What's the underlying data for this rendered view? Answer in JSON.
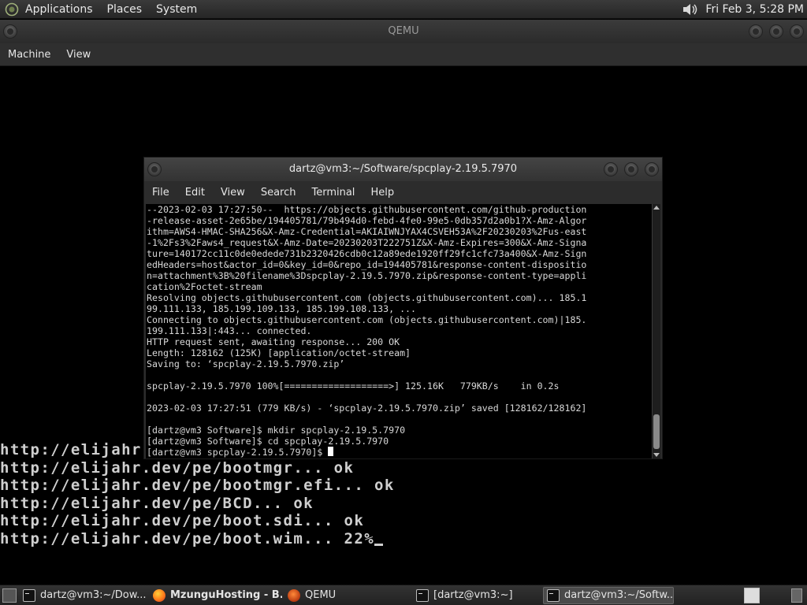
{
  "top_panel": {
    "menus": [
      "Applications",
      "Places",
      "System"
    ],
    "clock": "Fri Feb  3, 5:28 PM"
  },
  "qemu": {
    "title": "QEMU",
    "menus": [
      "Machine",
      "View"
    ],
    "screen_lines": [
      "http://elijahr",
      "http://elijahr.dev/pe/bootmgr... ok",
      "http://elijahr.dev/pe/bootmgr.efi... ok",
      "http://elijahr.dev/pe/BCD... ok",
      "http://elijahr.dev/pe/boot.sdi... ok",
      "http://elijahr.dev/pe/boot.wim... 22%"
    ]
  },
  "terminal": {
    "title": "dartz@vm3:~/Software/spcplay-2.19.5.7970",
    "menus": [
      "File",
      "Edit",
      "View",
      "Search",
      "Terminal",
      "Help"
    ],
    "lines": [
      "--2023-02-03 17:27:50--  https://objects.githubusercontent.com/github-production",
      "-release-asset-2e65be/194405781/79b494d0-febd-4fe0-99e5-0db357d2a0b1?X-Amz-Algor",
      "ithm=AWS4-HMAC-SHA256&X-Amz-Credential=AKIAIWNJYAX4CSVEH53A%2F20230203%2Fus-east",
      "-1%2Fs3%2Faws4_request&X-Amz-Date=20230203T222751Z&X-Amz-Expires=300&X-Amz-Signa",
      "ture=140172cc11c0de0edede731b2320426cdb0c12a89ede1920ff29fc1cfc73a400&X-Amz-Sign",
      "edHeaders=host&actor_id=0&key_id=0&repo_id=194405781&response-content-dispositio",
      "n=attachment%3B%20filename%3Dspcplay-2.19.5.7970.zip&response-content-type=appli",
      "cation%2Foctet-stream",
      "Resolving objects.githubusercontent.com (objects.githubusercontent.com)... 185.1",
      "99.111.133, 185.199.109.133, 185.199.108.133, ...",
      "Connecting to objects.githubusercontent.com (objects.githubusercontent.com)|185.",
      "199.111.133|:443... connected.",
      "HTTP request sent, awaiting response... 200 OK",
      "Length: 128162 (125K) [application/octet-stream]",
      "Saving to: ‘spcplay-2.19.5.7970.zip’",
      "",
      "spcplay-2.19.5.7970 100%[===================>] 125.16K   779KB/s    in 0.2s",
      "",
      "2023-02-03 17:27:51 (779 KB/s) - ‘spcplay-2.19.5.7970.zip’ saved [128162/128162]",
      "",
      "[dartz@vm3 Software]$ mkdir spcplay-2.19.5.7970",
      "[dartz@vm3 Software]$ cd spcplay-2.19.5.7970"
    ],
    "prompt": "[dartz@vm3 spcplay-2.19.5.7970]$ "
  },
  "taskbar": {
    "tasks": [
      {
        "label": "dartz@vm3:~/Dow...",
        "icon": "terminal-icon"
      },
      {
        "label": "MzunguHosting - B...",
        "icon": "firefox-icon"
      },
      {
        "label": "QEMU",
        "icon": "qemu-icon"
      },
      {
        "label": "[dartz@vm3:~]",
        "icon": "terminal-icon"
      },
      {
        "label": "dartz@vm3:~/Softw...",
        "icon": "terminal-icon"
      }
    ]
  }
}
